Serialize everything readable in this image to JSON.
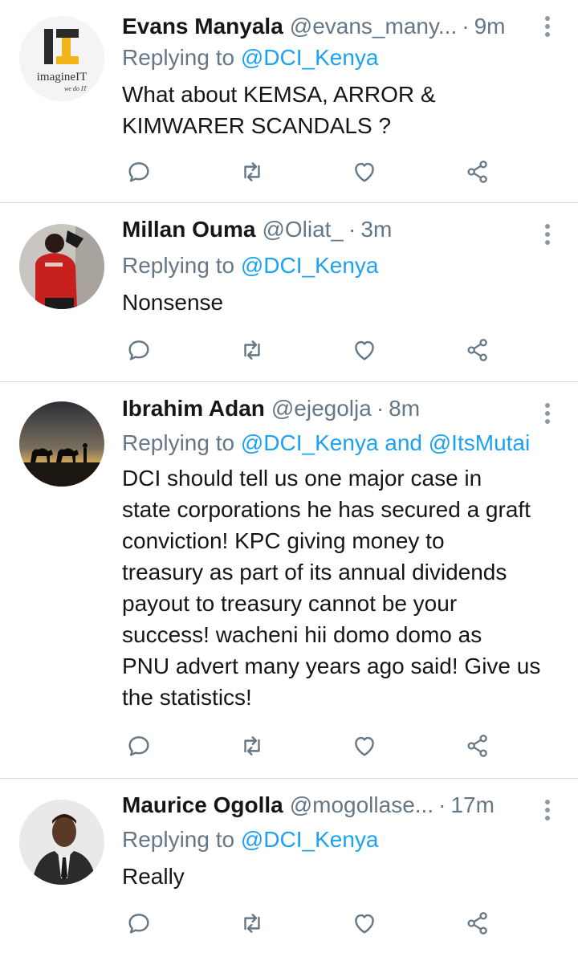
{
  "tweets": [
    {
      "name": "Evans Manyala",
      "handle": "@evans_many...",
      "time": "9m",
      "replying_prefix": "Replying to",
      "replying_to": "@DCI_Kenya",
      "replying_more": "",
      "text_lines": [
        "What about KEMSA, ARROR &",
        "KIMWARER SCANDALS ?"
      ],
      "avatar_text": {
        "brand": "imagineIT",
        "tagline": "we do IT"
      }
    },
    {
      "name": "Millan Ouma",
      "handle": "@Oliat_",
      "time": "3m",
      "replying_prefix": "Replying to",
      "replying_to": "@DCI_Kenya",
      "replying_more": "",
      "text_lines": [
        "Nonsense"
      ]
    },
    {
      "name": "Ibrahim Adan",
      "handle": "@ejegolja",
      "time": "8m",
      "replying_prefix": "Replying to",
      "replying_to": "@DCI_Kenya and @ItsMutai",
      "replying_more": "",
      "text_lines": [
        "DCI should tell us one major case in",
        "state corporations he has secured a graft",
        "conviction! KPC giving money to",
        "treasury as part of its annual dividends",
        "payout to treasury cannot be your",
        "success! wacheni hii domo domo as",
        "PNU advert many years ago said! Give us",
        "the statistics!"
      ]
    },
    {
      "name": "Maurice Ogolla",
      "handle": "@mogollase...",
      "time": "17m",
      "replying_prefix": "Replying to",
      "replying_to": "@DCI_Kenya",
      "replying_more": "",
      "text_lines": [
        "Really"
      ]
    }
  ],
  "icons": {
    "reply": "reply-icon",
    "retweet": "retweet-icon",
    "like": "heart-icon",
    "share": "share-icon",
    "menu": "more-vertical-icon"
  },
  "colors": {
    "link": "#1da1f2",
    "secondary_text": "#657786",
    "icon": "#657786",
    "divider": "#d6dbe0"
  }
}
